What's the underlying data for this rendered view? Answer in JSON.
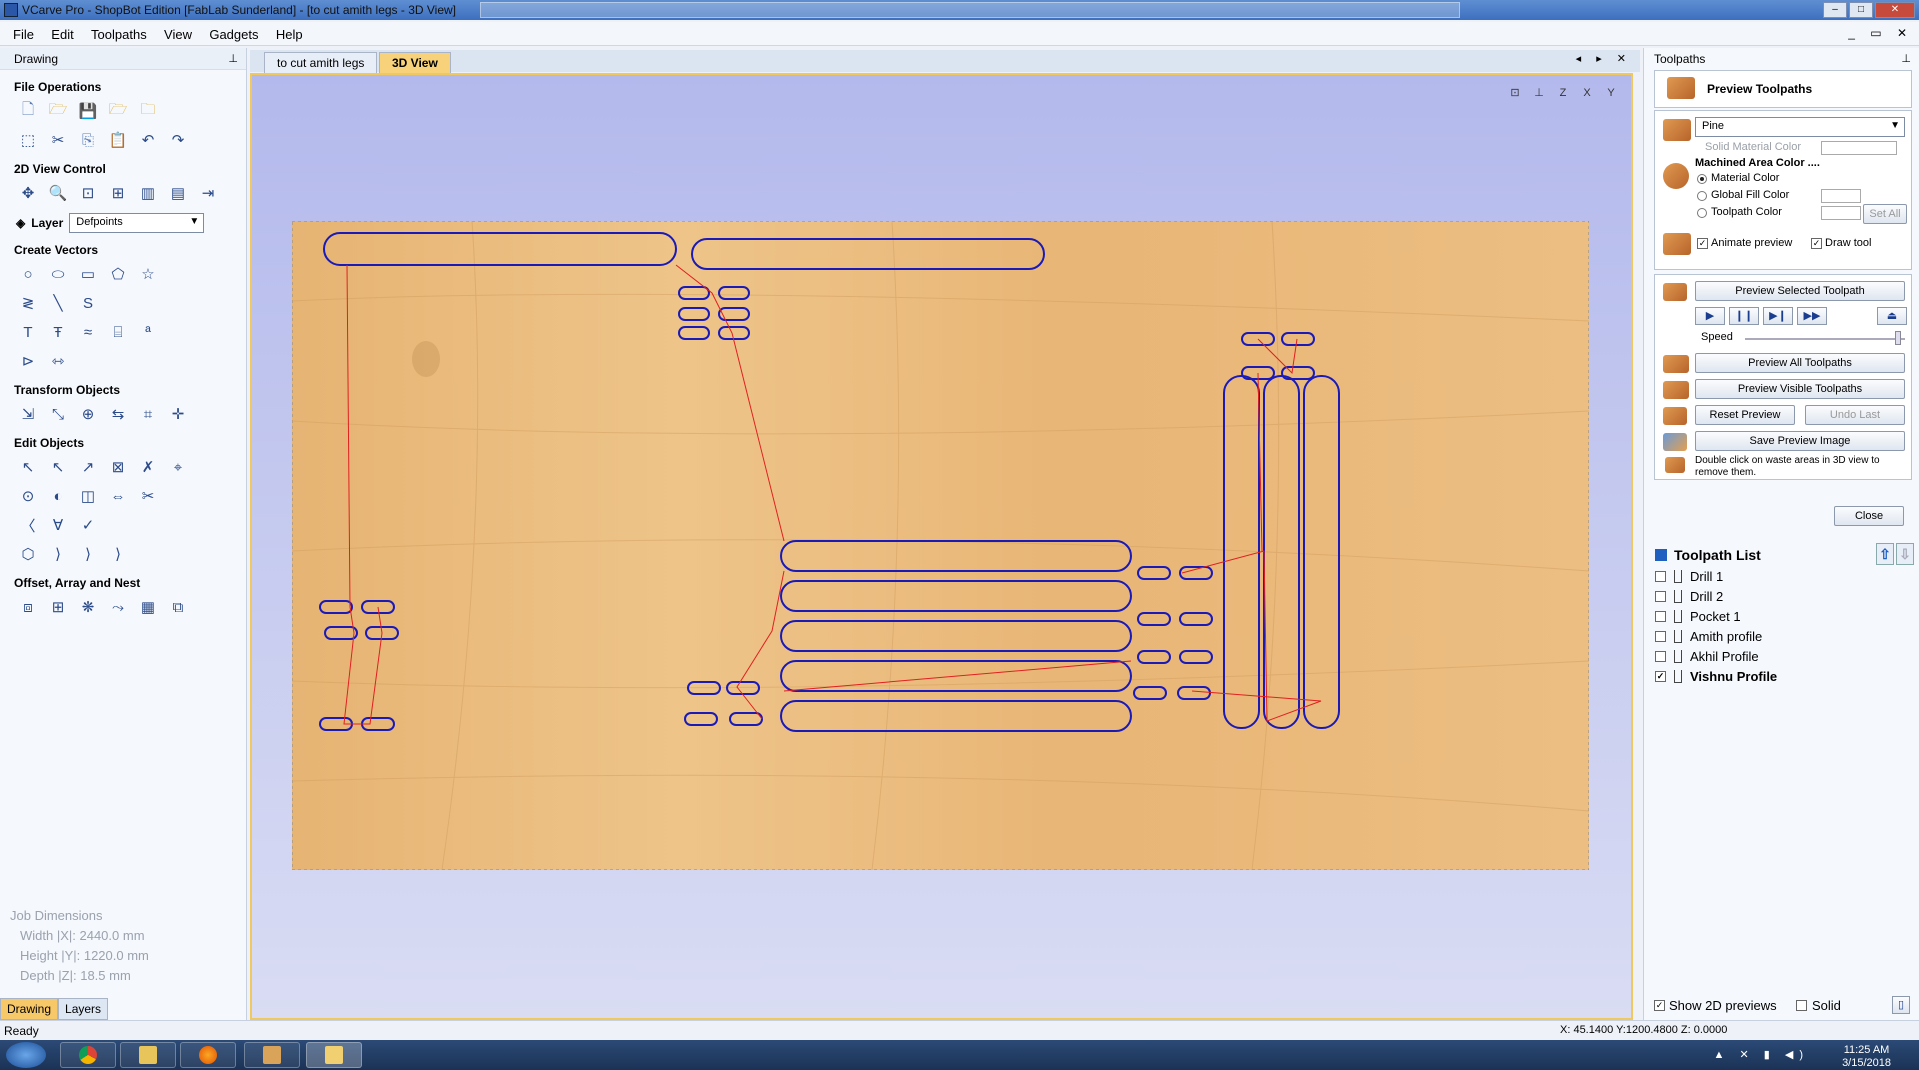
{
  "window": {
    "title": "VCarve Pro - ShopBot Edition [FabLab Sunderland] - [to cut amith legs - 3D View]"
  },
  "menu": [
    "File",
    "Edit",
    "Toolpaths",
    "View",
    "Gadgets",
    "Help"
  ],
  "left_panel": {
    "header": "Drawing",
    "sections": {
      "file_ops": "File Operations",
      "view_control": "2D View Control",
      "create_vectors": "Create Vectors",
      "transform": "Transform Objects",
      "edit": "Edit Objects",
      "offset": "Offset, Array and Nest"
    },
    "layer_label": "Layer",
    "layer_value": "Defpoints",
    "job_dimensions": {
      "title": "Job Dimensions",
      "width": "Width  |X|: 2440.0 mm",
      "height": "Height |Y|: 1220.0 mm",
      "depth": "Depth  |Z|: 18.5 mm"
    },
    "tabs": [
      "Drawing",
      "Layers"
    ]
  },
  "doc_tabs": [
    "to cut amith legs",
    "3D View"
  ],
  "view_icons": [
    "fit-icon",
    "iso-icon",
    "z-axis-icon",
    "x-axis-icon",
    "y-axis-icon"
  ],
  "right_panel": {
    "header": "Toolpaths",
    "preview_title": "Preview Toolpaths",
    "material": "Pine",
    "solid_material_color": "Solid Material Color",
    "machined_area_color": "Machined Area Color ....",
    "material_color": "Material Color",
    "global_fill_color": "Global Fill Color",
    "toolpath_color": "Toolpath Color",
    "set_all": "Set All",
    "animate_preview": "Animate preview",
    "draw_tool": "Draw tool",
    "preview_selected": "Preview Selected Toolpath",
    "speed": "Speed",
    "preview_all": "Preview All Toolpaths",
    "preview_visible": "Preview Visible Toolpaths",
    "reset_preview": "Reset Preview",
    "undo_last": "Undo Last",
    "save_preview_image": "Save Preview Image",
    "hint": "Double click on waste areas in 3D view to remove them.",
    "close": "Close",
    "toolpath_list_title": "Toolpath List",
    "toolpaths": [
      {
        "name": "Drill 1",
        "checked": false
      },
      {
        "name": "Drill 2",
        "checked": false
      },
      {
        "name": "Pocket 1",
        "checked": false
      },
      {
        "name": "Amith profile",
        "checked": false
      },
      {
        "name": "Akhil Profile",
        "checked": false
      },
      {
        "name": "Vishnu Profile",
        "checked": true
      }
    ],
    "show_2d_previews": "Show 2D previews",
    "solid": "Solid"
  },
  "status": {
    "text": "Ready",
    "coords": "X: 45.1400 Y:1200.4800 Z: 0.0000"
  },
  "clock": {
    "time": "11:25 AM",
    "date": "3/15/2018"
  },
  "colors": {
    "wood": "#e9b878",
    "vector": "#1a1ab8",
    "rapid": "#e02020",
    "active_tab": "#f7d27a"
  }
}
